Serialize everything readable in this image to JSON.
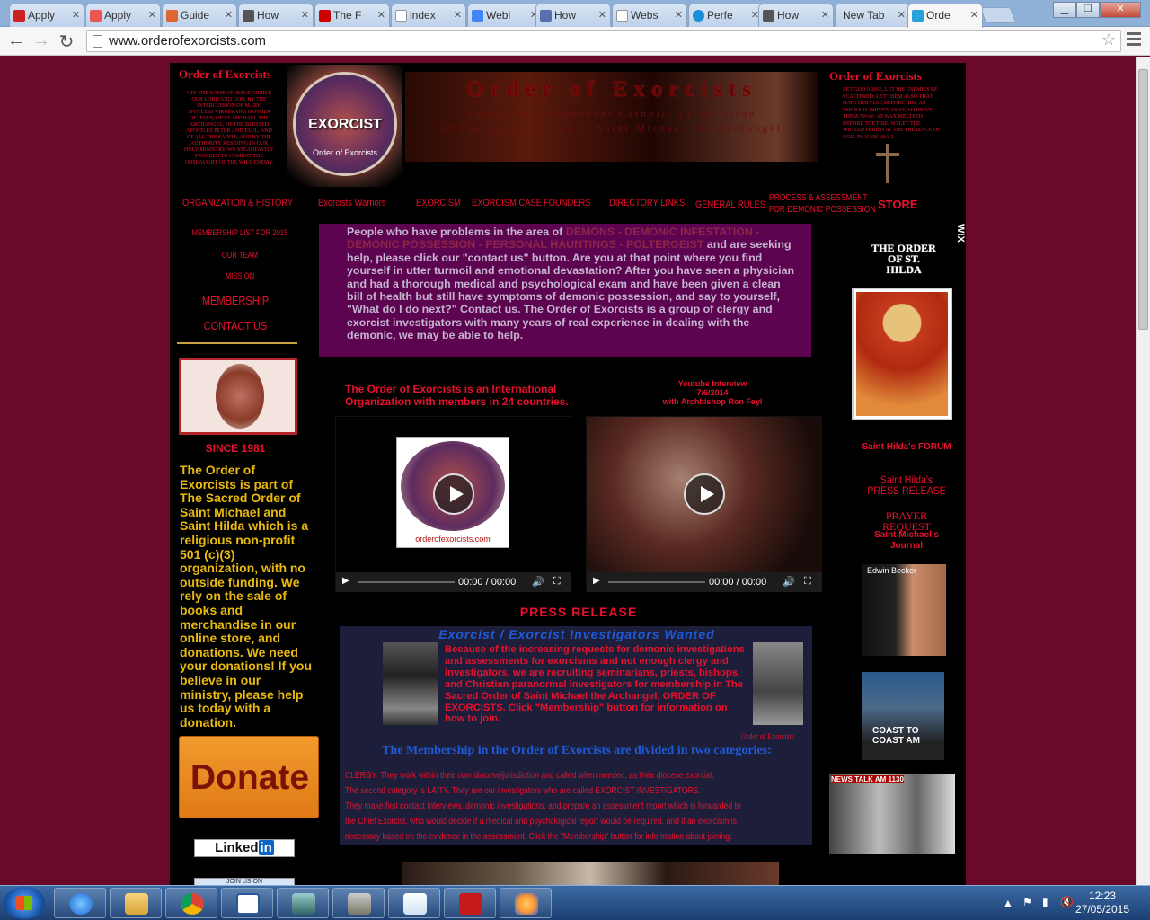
{
  "browser": {
    "tabs": [
      {
        "label": "Apply",
        "color": "#c22"
      },
      {
        "label": "Apply",
        "color": "#e55"
      },
      {
        "label": "Guide",
        "color": "#d63"
      },
      {
        "label": "How",
        "color": "#555"
      },
      {
        "label": "The F",
        "color": "#c00"
      },
      {
        "label": "index",
        "color": "#ddd"
      },
      {
        "label": "Webl",
        "color": "#4285f4"
      },
      {
        "label": "How",
        "color": "#5a6fb0"
      },
      {
        "label": "Webs",
        "color": "#ddd"
      },
      {
        "label": "Perfe",
        "color": "#1a8fd8"
      },
      {
        "label": "How",
        "color": "#555"
      },
      {
        "label": "New Tab",
        "color": "transparent"
      },
      {
        "label": "Orde",
        "color": "#2aa0d8"
      }
    ],
    "url": "www.orderofexorcists.com",
    "window_controls": [
      "minimize",
      "maximize",
      "close"
    ]
  },
  "header": {
    "left_title": "Order of Exorcists",
    "left_text": "+ IN THE NAME OF JESUS CHRIST, OUR LORD AND GOD, BY THE INTERCESSION OF MARY, SPOTLESS VIRGIN AND MOTHER OF JESUS, OF ST. MICHAEL THE ARCHANGEL, OF THE BLESSED APOSTLES PETER AND PAUL, AND OF ALL THE SAINTS, AND BY THE AUTHORITY RESIDING IN OUR HOLY MINISTRY, WE STEADFASTLY PROCEED TO COMBAT THE ONSLAUGHT OF THE WILY ENEMY.",
    "emblem_text": "EXORCIST",
    "emblem_sub": "Order of Exorcists",
    "banner_title": "Order of Exorcists",
    "banner_line1": "Under the Independent Catholic jurisdiction",
    "banner_line2": "of The Sacred Order of Saint Michael the Archangel",
    "right_title": "Order of Exorcists",
    "right_text": "LET GOD ARISE, LET HIS ENEMIES BE SCATTERED; LET THEM ALSO THAT HATE HIM FLEE BEFORE HIM. AS SMOKE IS DRIVEN AWAY, SO DRIVE THEM AWAY: AS WAX MELTETH BEFORE THE FIRE, SO LET THE WICKED PERISH AT THE PRESENCE OF GOD. PSALMS 68:1-2"
  },
  "nav": [
    "ORGANIZATION & HISTORY",
    "Exorcists Warriors",
    "EXORCISM",
    "EXORCISM CASE",
    "FOUNDERS",
    "DIRECTORY LINKS",
    "GENERAL RULES",
    "PROCESS & ASSESSMENT",
    "FOR DEMONIC POSSESSION",
    "STORE"
  ],
  "left_nav": {
    "membership_list": "MEMBERSHIP LIST FOR 2015",
    "our_team": "OUR TEAM",
    "mission": "MISSION",
    "membership": "MEMBERSHIP",
    "contact": "CONTACT US"
  },
  "left": {
    "since": "SINCE 1981",
    "paragraph": "The Order of Exorcists is part of The Sacred Order of Saint Michael and Saint Hilda which is a religious non-profit 501 (c)(3) organization, with no outside funding. We rely on the sale of books and merchandise  in our online store, and donations. We need your donations! If you believe in our ministry, please help us today with a donation.",
    "donate": "Donate",
    "linkedin_a": "Linked",
    "linkedin_b": "in",
    "join_us": "JOIN US ON"
  },
  "main": {
    "info_intro": "People who have problems in the area of ",
    "info_highlight": "DEMONS - DEMONIC INFESTATION - DEMONIC POSSESSION - PERSONAL HAUNTINGS - POLTERGEIST",
    "info_rest": " and are seeking help, please click our \"contact us\" button. Are you at that point where you find yourself in utter turmoil and emotional devastation? After you have seen a physician and had a thorough medical and psychological exam and have been given a clean bill of health but still have symptoms of demonic possession, and say to yourself, \"What do I do next?\" Contact us. The Order of Exorcists is a group of clergy and exorcist investigators with many years of real experience in dealing with the demonic, we may be able to help.",
    "intl": "The Order of Exorcists is an International Organization with members in 24 countries.",
    "yt_line1": "Youtube Interview",
    "yt_line2": "7/6/2014",
    "yt_line3": "with Archbishop Ron Feyl",
    "video1_time": "00:00 / 00:00",
    "video2_time": "00:00 / 00:00",
    "video1_caption": "orderofexorcists.com",
    "press": "PRESS RELEASE",
    "recruit_title": "Exorcist / Exorcist Investigators Wanted",
    "recruit_body": "Because of the increasing requests for demonic investigations and assessments for exorcisms and not enough clergy and investigators, we are recruiting seminarians, priests, bishops, and Christian paranormal investigators for membership in The Sacred Order of Saint Michael the Archangel, ORDER OF EXORCISTS. Click \"Membership\" button for information on how to join.",
    "recruit_caption": "Order of Exorcists",
    "categories_title": "The Membership in the Order of Exorcists are divided in two categories:",
    "clergy_1": "CLERGY: They work within their own diocese/jurisdiction and called when needed, as their diocese exorcist.",
    "clergy_2": "The second category is LAITY. They are our investigators who are called EXORCIST INVESTIGATORS.",
    "clergy_3": "They make first contact interviews, demonic investigations, and prepare an assessment report which is forwarded to",
    "clergy_4": "the Chief Exorcist, who would decide if a medical and psychological report would be required, and if an exorcism is",
    "clergy_5": "necessary based on the evidence in the assessment. Click the \"Membership\" button for information about joining."
  },
  "right": {
    "store": "STORE",
    "hilda_title": "THE ORDER OF ST. HILDA",
    "forum": "Saint Hilda's FORUM",
    "press_release": "Saint Hilda's PRESS RELEASE",
    "prayer": "PRAYER REQUEST",
    "journal": "Saint Michael's Journal",
    "thumb1": "Edwin Becker",
    "thumb2": "COAST TO COAST AM",
    "thumb3": "NEWS TALK AM 1130"
  },
  "wix": "WIX",
  "taskbar": {
    "time": "12:23",
    "date": "27/05/2015",
    "apps": [
      "ie-icon",
      "explorer-icon",
      "chrome-icon",
      "word-icon",
      "network-icon",
      "gimp-icon",
      "notepad-icon",
      "acrobat-icon",
      "paint-icon"
    ]
  }
}
